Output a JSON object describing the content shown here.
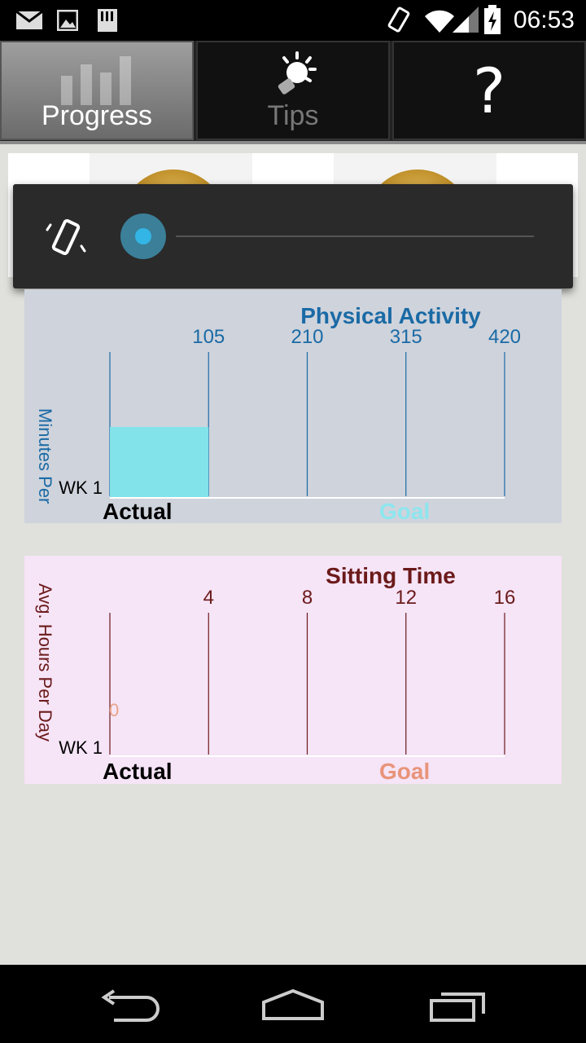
{
  "status_bar": {
    "time": "06:53",
    "icons": [
      "email-icon",
      "image-icon",
      "sd-card-icon",
      "vibrate-icon",
      "wifi-icon",
      "signal-icon",
      "battery-charging-icon"
    ]
  },
  "tabs": [
    {
      "label": "Progress",
      "icon": "bar-chart-icon",
      "selected": true
    },
    {
      "label": "Tips",
      "icon": "lightbulb-icon",
      "selected": false
    },
    {
      "label": "?",
      "icon": "help-icon",
      "selected": false
    }
  ],
  "volume_overlay": {
    "icon": "vibrate-icon",
    "level": 0
  },
  "charts": {
    "physical_activity": {
      "title": "Physical Activity",
      "y_label": "Minutes Per",
      "row_label": "WK 1",
      "legend_actual": "Actual",
      "legend_goal": "Goal",
      "ticks": [
        "105",
        "210",
        "315",
        "420"
      ],
      "colors": {
        "bg": "#cfd3dc",
        "text": "#1a6aa5",
        "bar": "#82e3ea",
        "actual": "#000000",
        "goal": "#8ee6ee"
      }
    },
    "sitting_time": {
      "title": "Sitting Time",
      "y_label": "Avg. Hours Per Day",
      "row_label": "WK 1",
      "legend_actual": "Actual",
      "legend_goal": "Goal",
      "ticks": [
        "4",
        "8",
        "12",
        "16"
      ],
      "value_label": "0",
      "colors": {
        "bg": "#f6e4f7",
        "text": "#6b1a1a",
        "actual": "#000000",
        "goal": "#e8947a"
      }
    }
  },
  "chart_data": [
    {
      "type": "bar",
      "title": "Physical Activity",
      "ylabel": "Minutes Per",
      "categories": [
        "WK 1"
      ],
      "series": [
        {
          "name": "Actual",
          "values": [
            105
          ]
        }
      ],
      "xlim": [
        0,
        420
      ],
      "ticks": [
        105,
        210,
        315,
        420
      ],
      "orientation": "horizontal",
      "grid": true
    },
    {
      "type": "bar",
      "title": "Sitting Time",
      "ylabel": "Avg. Hours Per Day",
      "categories": [
        "WK 1"
      ],
      "series": [
        {
          "name": "Actual",
          "values": [
            0
          ]
        }
      ],
      "xlim": [
        0,
        16
      ],
      "ticks": [
        4,
        8,
        12,
        16
      ],
      "orientation": "horizontal",
      "grid": true
    }
  ],
  "nav": {
    "back": "back-icon",
    "home": "home-icon",
    "recents": "recents-icon"
  }
}
